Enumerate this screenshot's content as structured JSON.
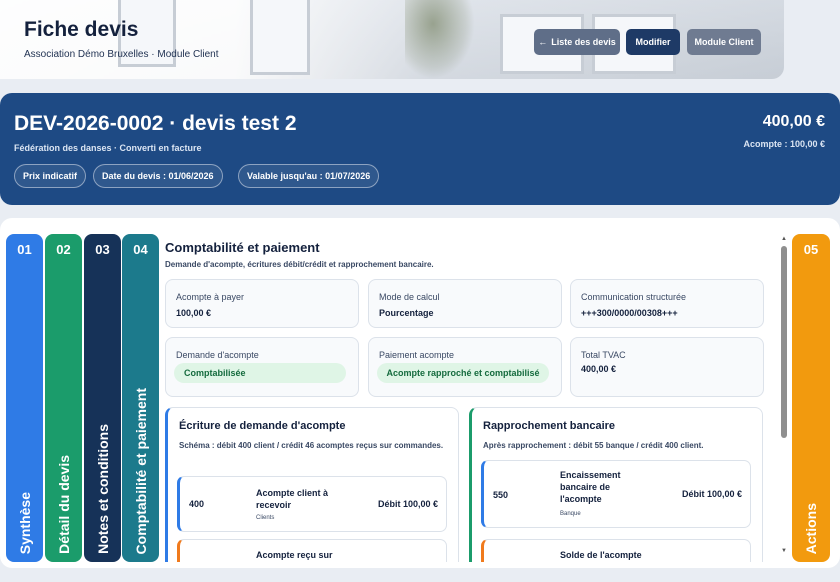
{
  "header": {
    "title": "Fiche devis",
    "subtitle": "Association Démo Bruxelles · Module Client",
    "buttons": {
      "list": "Liste des devis",
      "edit": "Modifier",
      "module": "Module Client"
    }
  },
  "quote": {
    "title": "DEV-2026-0002 · devis test 2",
    "subtitle": "Fédération des danses · Converti en facture",
    "amount": "400,00 €",
    "deposit": "Acompte : 100,00 €",
    "chips": [
      "Prix indicatif",
      "Date du devis : 01/06/2026",
      "Valable jusqu'au : 01/07/2026"
    ]
  },
  "tabs": [
    {
      "num": "01",
      "label": "Synthèse",
      "color": "#2f7be6"
    },
    {
      "num": "02",
      "label": "Détail du devis",
      "color": "#1b9c6b"
    },
    {
      "num": "03",
      "label": "Notes et conditions",
      "color": "#163258"
    },
    {
      "num": "04",
      "label": "Comptabilité et paiement",
      "color": "#1c7a8c"
    },
    {
      "num": "05",
      "label": "Actions",
      "color": "#f29a0e"
    }
  ],
  "section": {
    "title": "Comptabilité et paiement",
    "subtitle": "Demande d'acompte, écritures débit/crédit et rapprochement bancaire.",
    "fields": [
      {
        "label": "Acompte à payer",
        "value": "100,00 €"
      },
      {
        "label": "Mode de calcul",
        "value": "Pourcentage"
      },
      {
        "label": "Communication structurée",
        "value": "+++300/0000/00308+++"
      },
      {
        "label": "Demande d'acompte",
        "value": "Comptabilisée"
      },
      {
        "label": "Paiement acompte",
        "value": "Acompte rapproché et comptabilisé"
      },
      {
        "label": "Total TVAC",
        "value": "400,00 €"
      }
    ]
  },
  "panels": {
    "left": {
      "title": "Écriture de demande d'acompte",
      "desc": "Schéma : débit 400 client / crédit 46 acomptes reçus sur commandes.",
      "lines": [
        {
          "account": "400",
          "label": "Acompte client à recevoir",
          "tag": "Clients",
          "amount": "Débit 100,00 €"
        },
        {
          "account": "",
          "label": "Acompte reçu sur",
          "tag": "",
          "amount": ""
        }
      ]
    },
    "right": {
      "title": "Rapprochement bancaire",
      "desc": "Après rapprochement : débit 55 banque / crédit 400 client.",
      "lines": [
        {
          "account": "550",
          "label": "Encaissement bancaire de l'acompte",
          "tag": "Banque",
          "amount": "Débit 100,00 €"
        },
        {
          "account": "",
          "label": "Solde de l'acompte",
          "tag": "",
          "amount": ""
        }
      ]
    }
  },
  "icons": {
    "back": "arrow-left-icon",
    "scroll_up": "triangle-up-icon",
    "scroll_down": "triangle-down-icon"
  }
}
